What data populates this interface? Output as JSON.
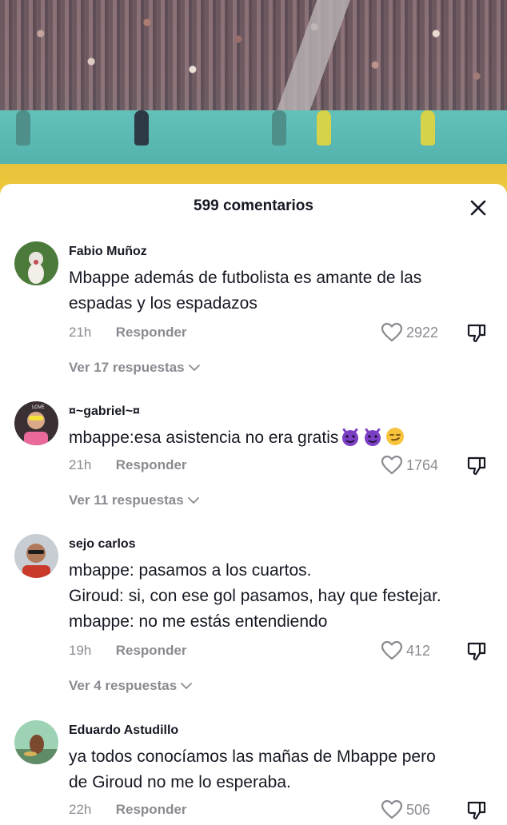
{
  "header": {
    "title": "599 comentarios"
  },
  "comments": [
    {
      "user": "Fabio Muñoz",
      "lines": [
        "Mbappe además de futbolista es amante de las",
        "espadas y los espadazos"
      ],
      "time": "21h",
      "reply_label": "Responder",
      "likes": "2922",
      "replies_label": "Ver 17 respuestas"
    },
    {
      "user": "¤~gabriel~¤",
      "lines": [
        "mbappe:esa asistencia no era gratis"
      ],
      "emojis": [
        "smiling-devil-emoji",
        "smiling-devil-emoji",
        "smirking-face-emoji"
      ],
      "time": "21h",
      "reply_label": "Responder",
      "likes": "1764",
      "replies_label": "Ver 11 respuestas"
    },
    {
      "user": "sejo carlos",
      "lines": [
        "mbappe: pasamos a los cuartos.",
        "Giroud: si, con ese gol pasamos, hay que festejar.",
        "mbappe: no me estás entendiendo"
      ],
      "time": "19h",
      "reply_label": "Responder",
      "likes": "412",
      "replies_label": "Ver 4 respuestas"
    },
    {
      "user": "Eduardo Astudillo",
      "lines": [
        "ya todos conocíamos las mañas de Mbappe pero",
        "de Giroud no me lo esperaba."
      ],
      "time": "22h",
      "reply_label": "Responder",
      "likes": "506"
    }
  ],
  "colors": {
    "text": "#161823",
    "muted": "#8a8b91",
    "wall": "#52b1ab",
    "stripe": "#f0c93a",
    "devil": "#7b3fc4",
    "smirk": "#f7c33a"
  },
  "icons": [
    "close-icon",
    "heart-outline-icon",
    "dislike-icon",
    "chevron-down-icon"
  ]
}
